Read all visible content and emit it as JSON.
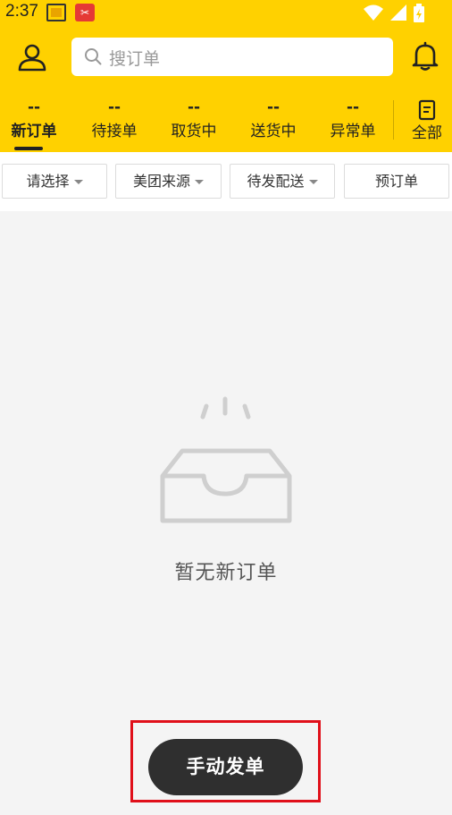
{
  "status_bar": {
    "time": "2:37",
    "notification_icons": [
      "app-icon",
      "tools-icon"
    ],
    "system_icons": [
      "wifi-icon",
      "signal-icon",
      "battery-charging-icon"
    ]
  },
  "header": {
    "search_placeholder": "搜订单"
  },
  "tabs": [
    {
      "count": "--",
      "label": "新订单",
      "active": true
    },
    {
      "count": "--",
      "label": "待接单",
      "active": false
    },
    {
      "count": "--",
      "label": "取货中",
      "active": false
    },
    {
      "count": "--",
      "label": "送货中",
      "active": false
    },
    {
      "count": "--",
      "label": "异常单",
      "active": false
    }
  ],
  "all_tab": {
    "label": "全部"
  },
  "filters": [
    {
      "label": "请选择",
      "dropdown": true
    },
    {
      "label": "美团来源",
      "dropdown": true
    },
    {
      "label": "待发配送",
      "dropdown": true
    },
    {
      "label": "预订单",
      "dropdown": false
    }
  ],
  "empty_state": {
    "text": "暂无新订单"
  },
  "primary_action": {
    "label": "手动发单"
  },
  "colors": {
    "brand_yellow": "#ffd100",
    "button_dark": "#2f2f2f",
    "highlight_red": "#e0101a"
  }
}
